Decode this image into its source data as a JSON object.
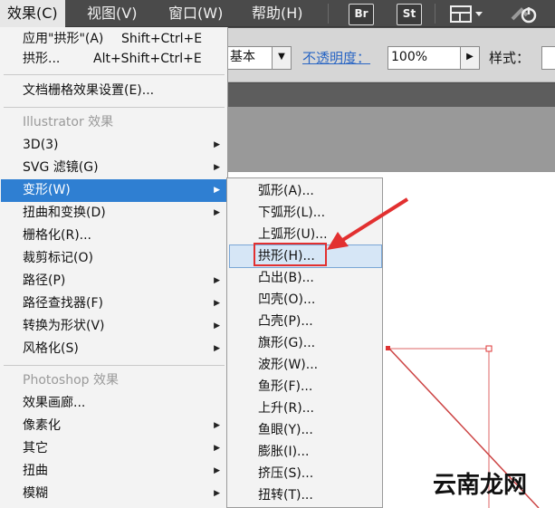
{
  "menubar": {
    "items": [
      "效果(C)",
      "视图(V)",
      "窗口(W)",
      "帮助(H)"
    ],
    "apps": [
      "Br",
      "St"
    ]
  },
  "controlbar": {
    "style_value": "基本",
    "opacity_label": "不透明度：",
    "opacity_value": "100%",
    "style_label": "样式："
  },
  "effect_menu": {
    "apply_last": {
      "label": "应用\"拱形\"(A)",
      "shortcut": "Shift+Ctrl+E"
    },
    "last": {
      "label": "拱形...",
      "shortcut": "Alt+Shift+Ctrl+E"
    },
    "raster_settings": "文档栅格效果设置(E)...",
    "illustrator_header": "Illustrator 效果",
    "illustrator_items": [
      "3D(3)",
      "SVG 滤镜(G)",
      "变形(W)",
      "扭曲和变换(D)",
      "栅格化(R)...",
      "裁剪标记(O)",
      "路径(P)",
      "路径查找器(F)",
      "转换为形状(V)",
      "风格化(S)"
    ],
    "photoshop_header": "Photoshop 效果",
    "photoshop_items": [
      "效果画廊...",
      "像素化",
      "其它",
      "扭曲",
      "模糊"
    ]
  },
  "warp_submenu": {
    "items": [
      "弧形(A)...",
      "下弧形(L)...",
      "上弧形(U)...",
      "拱形(H)...",
      "凸出(B)...",
      "凹壳(O)...",
      "凸壳(P)...",
      "旗形(G)...",
      "波形(W)...",
      "鱼形(F)...",
      "上升(R)...",
      "鱼眼(Y)...",
      "膨胀(I)...",
      "挤压(S)...",
      "扭转(T)..."
    ],
    "highlighted_index": 3
  },
  "watermark": "云南龙网",
  "colors": {
    "highlight": "#2f7fd2",
    "annotation": "#e23030"
  }
}
